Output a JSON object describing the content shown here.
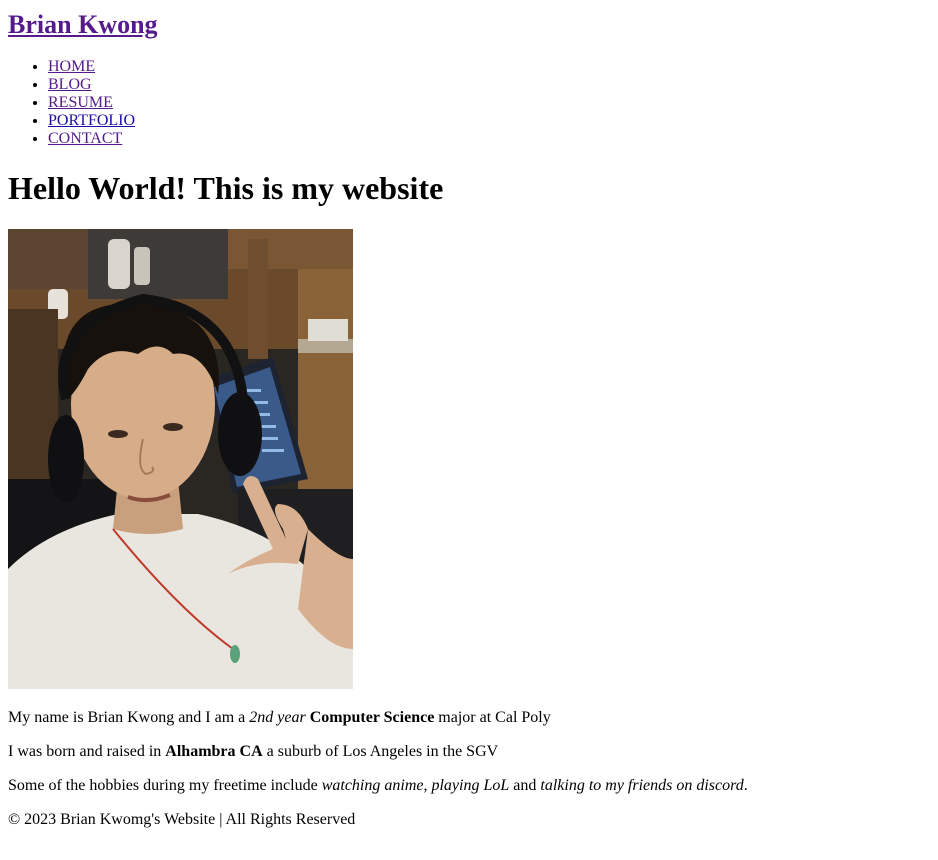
{
  "site": {
    "title": "Brian Kwong"
  },
  "nav": {
    "items": [
      "HOME",
      "BLOG",
      "RESUME",
      "PORTFOLIO",
      "CONTACT"
    ]
  },
  "main": {
    "heading": "Hello World! This is my website",
    "intro": {
      "t1": "My name is Brian Kwong and I am a ",
      "em1": "2nd year",
      "t2": " ",
      "strong1": "Computer Science",
      "t3": " major at Cal Poly"
    },
    "hometown": {
      "t1": "I was born and raised in ",
      "strong1": "Alhambra CA",
      "t2": " a suburb of Los Angeles in the SGV"
    },
    "hobbies": {
      "t1": "Some of the hobbies during my freetime include ",
      "em1": "watching anime",
      "t2": ", ",
      "em2": "playing LoL",
      "t3": " and ",
      "em3": "talking to my friends on discord",
      "t4": "."
    }
  },
  "footer": {
    "text": "© 2023 Brian Kwomg's Website | All Rights Reserved"
  }
}
